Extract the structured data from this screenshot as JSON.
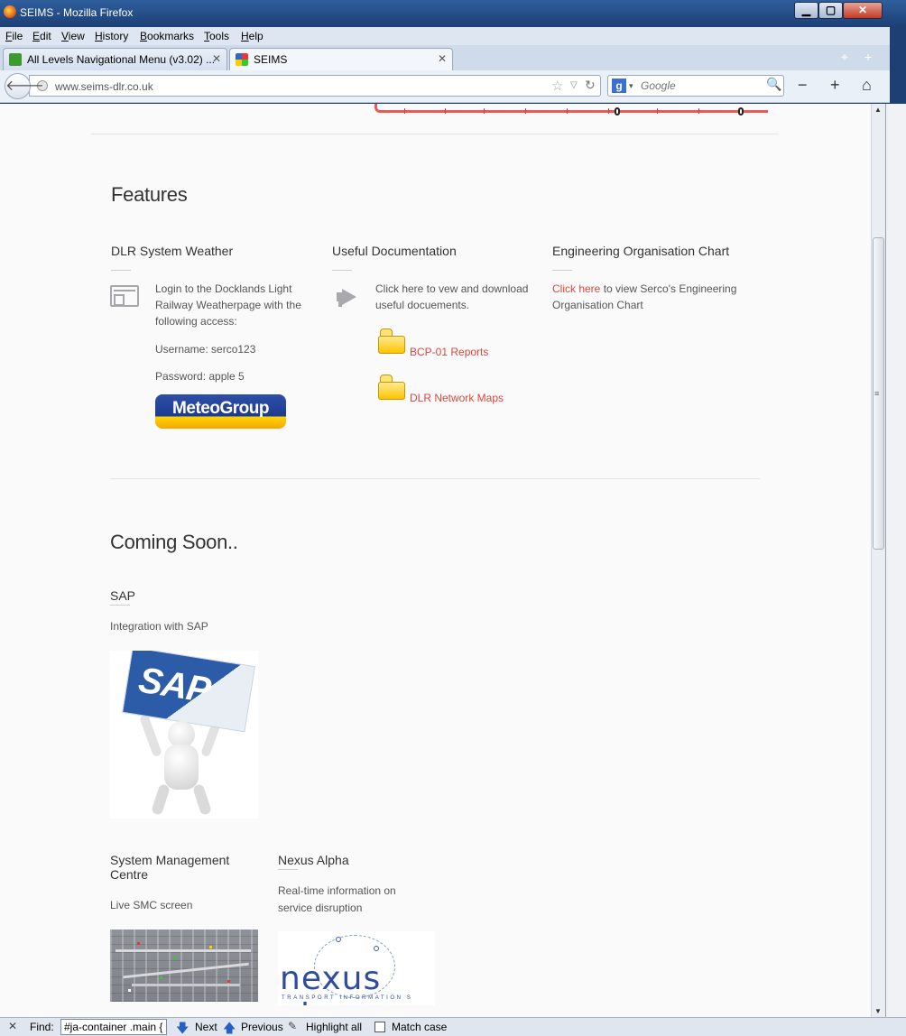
{
  "window": {
    "title": "SEIMS - Mozilla Firefox",
    "min_glyph": "▁",
    "max_glyph": "▢",
    "close_glyph": "✕"
  },
  "menu": {
    "items": [
      "File",
      "Edit",
      "View",
      "History",
      "Bookmarks",
      "Tools",
      "Help"
    ]
  },
  "tabs": [
    {
      "title": "All Levels Navigational Menu (v3.02) ...",
      "close": "✕",
      "active": false
    },
    {
      "title": "SEIMS",
      "close": "✕",
      "active": true
    }
  ],
  "tabstrip": {
    "groups_glyph": "⌖",
    "newtab_glyph": "+"
  },
  "navbar": {
    "back_glyph": "🡐",
    "url": "www.seims-dlr.co.uk",
    "star_glyph": "☆",
    "drop_glyph": "▽",
    "reload_glyph": "↻",
    "search_engine_glyph": "g",
    "search_drop_glyph": "▾",
    "search_placeholder": "Google",
    "search_glyph": "🔍",
    "zoom_out_glyph": "−",
    "zoom_in_glyph": "+",
    "home_glyph": "⌂"
  },
  "page": {
    "features": {
      "heading": "Features",
      "weather": {
        "title": "DLR System Weather",
        "intro": "Login to the Docklands Light Railway Weatherpage with the following access:",
        "username": "Username: serco123",
        "password": "Password: apple 5",
        "logo_text": "MeteoGroup"
      },
      "docs": {
        "title": "Useful Documentation",
        "intro": "Click here to vew and download useful docuements.",
        "links": [
          "BCP-01 Reports",
          "DLR Network Maps"
        ]
      },
      "org": {
        "title": "Engineering Organisation Chart",
        "link": "Click here",
        "text": " to view Serco's Engineering Organisation Chart"
      }
    },
    "coming_soon": {
      "heading": "Coming Soon..",
      "sap": {
        "title": "SAP",
        "desc": "Integration with SAP",
        "image_text": "SAP"
      },
      "smc": {
        "title": "System Management Centre",
        "desc": "Live SMC screen"
      },
      "nexus": {
        "title": "Nexus Alpha",
        "desc": "Real-time information on service disruption",
        "image_word": "nexus alp",
        "image_sub": "TRANSPORT INFORMATION S"
      }
    }
  },
  "scrollbar": {
    "up_glyph": "▲",
    "down_glyph": "▼",
    "grip_glyph": "≡"
  },
  "findbar": {
    "close_glyph": "✕",
    "label": "Find:",
    "value": "#ja-container .main {",
    "next_glyph": "🡇",
    "next": "Next",
    "prev_glyph": "🡅",
    "previous": "Previous",
    "highlight_glyph": "✎",
    "highlight": "Highlight all",
    "match_case": "Match case"
  },
  "colors": {
    "link": "#d9473d",
    "heading": "#333333",
    "body_text": "#555555",
    "page_bg": "#fafafb"
  }
}
